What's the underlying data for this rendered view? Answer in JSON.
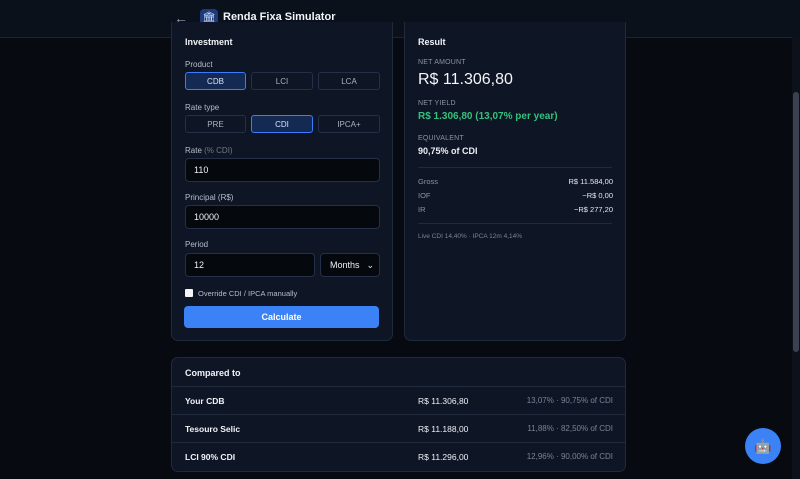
{
  "header": {
    "title": "Renda Fixa Simulator",
    "back_icon": "←",
    "logo_icon": "🏛"
  },
  "investment": {
    "title": "Investment",
    "product_label": "Product",
    "products": [
      "CDB",
      "LCI",
      "LCA"
    ],
    "rate_type_label": "Rate type",
    "rate_types": [
      "PRE",
      "CDI",
      "IPCA+"
    ],
    "rate_label": "Rate",
    "rate_unit": "(% CDI)",
    "rate_value": "110",
    "principal_label": "Principal (R$)",
    "principal_value": "10000",
    "period_label": "Period",
    "period_value": "12",
    "period_unit": "Months",
    "override_label": "Override CDI / IPCA manually",
    "calculate_label": "Calculate"
  },
  "result": {
    "title": "Result",
    "net_amount_label": "NET AMOUNT",
    "net_amount": "R$ 11.306,80",
    "net_yield_label": "NET YIELD",
    "net_yield": "R$ 1.306,80 (13,07% per year)",
    "equivalent_label": "EQUIVALENT",
    "equivalent": "90,75% of CDI",
    "rows": [
      {
        "label": "Gross",
        "value": "R$ 11.584,00"
      },
      {
        "label": "IOF",
        "value": "−R$ 0,00"
      },
      {
        "label": "IR",
        "value": "−R$ 277,20"
      }
    ],
    "footnote": "Live CDI 14,40% · IPCA 12m 4,14%"
  },
  "compare": {
    "title": "Compared to",
    "rows": [
      {
        "name": "Your CDB",
        "amount": "R$ 11.306,80",
        "yield": "13,07% · 90,75% of CDI"
      },
      {
        "name": "Tesouro Selic",
        "amount": "R$ 11.188,00",
        "yield": "11,88% · 82,50% of CDI"
      },
      {
        "name": "LCI 90% CDI",
        "amount": "R$ 11.296,00",
        "yield": "12,96% · 90,00% of CDI"
      }
    ]
  },
  "assistant_icon": "🤖",
  "colors": {
    "accent": "#3b82f6",
    "positive": "#34c27a",
    "background": "#070b11"
  }
}
